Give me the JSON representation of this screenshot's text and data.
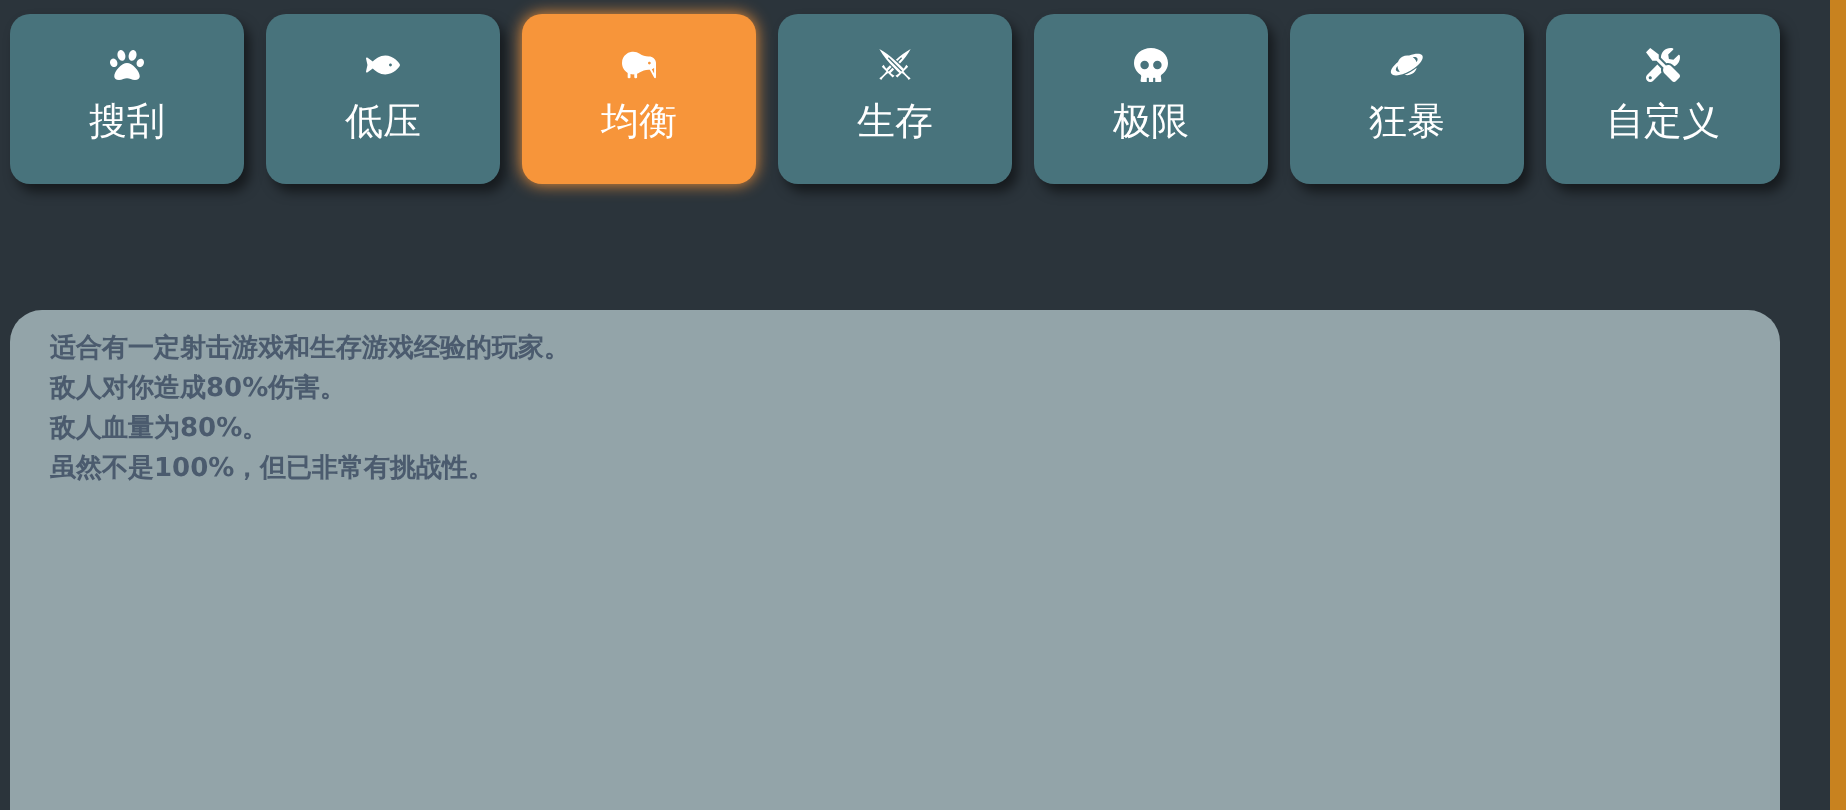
{
  "modes": [
    {
      "label": "搜刮",
      "selected": false
    },
    {
      "label": "低压",
      "selected": false
    },
    {
      "label": "均衡",
      "selected": true
    },
    {
      "label": "生存",
      "selected": false
    },
    {
      "label": "极限",
      "selected": false
    },
    {
      "label": "狂暴",
      "selected": false
    },
    {
      "label": "自定义",
      "selected": false
    }
  ],
  "description": {
    "lines": [
      "适合有一定射击游戏和生存游戏经验的玩家。",
      "敌人对你造成80%伤害。",
      "敌人血量为80%。",
      "虽然不是100%，但已非常有挑战性。"
    ]
  }
}
